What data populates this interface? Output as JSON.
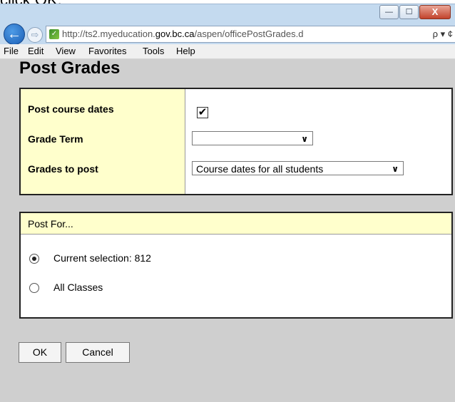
{
  "crop_text": "click OK.",
  "window": {
    "controls": {
      "minimize": "—",
      "maximize": "☐",
      "close": "X"
    }
  },
  "nav": {
    "back": "←",
    "forward": "⇨",
    "url_prefix": "http://ts2.myeducation.",
    "url_domain": "gov.bc.ca",
    "url_path": "/aspen/officePostGrades.d",
    "tools": "ρ ▾ ¢"
  },
  "menu": {
    "file": "File",
    "edit": "Edit",
    "view": "View",
    "favorites": "Favorites",
    "tools": "Tools",
    "help": "Help"
  },
  "page": {
    "title": "Post Grades",
    "form": {
      "post_course_dates_label": "Post course dates",
      "post_course_dates_checked": true,
      "grade_term_label": "Grade Term",
      "grade_term_value": "",
      "grades_to_post_label": "Grades to post",
      "grades_to_post_value": "Course dates for all students"
    },
    "post_for": {
      "header": "Post For...",
      "option_current": "Current selection: 812",
      "option_all": "All Classes",
      "selected": "current"
    },
    "buttons": {
      "ok": "OK",
      "cancel": "Cancel"
    }
  },
  "colors": {
    "label_bg": "#ffffcc",
    "content_bg": "#cfcfcf",
    "chrome_bg": "#c4daef"
  }
}
